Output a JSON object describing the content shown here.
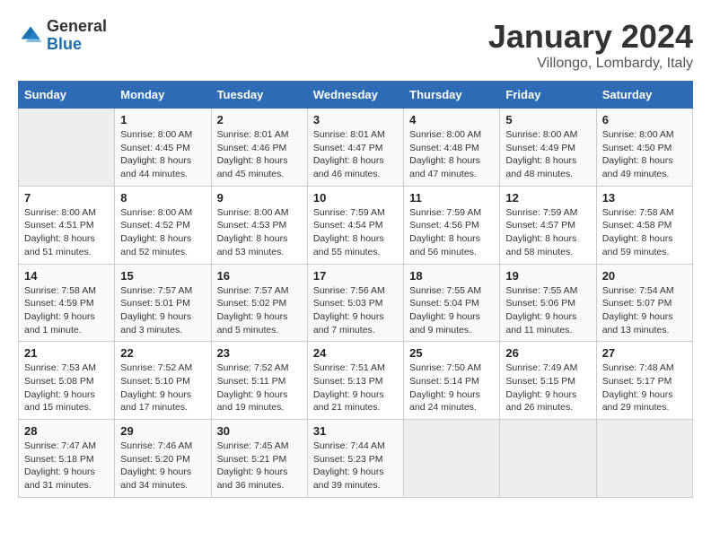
{
  "logo": {
    "general": "General",
    "blue": "Blue"
  },
  "title": "January 2024",
  "subtitle": "Villongo, Lombardy, Italy",
  "days_header": [
    "Sunday",
    "Monday",
    "Tuesday",
    "Wednesday",
    "Thursday",
    "Friday",
    "Saturday"
  ],
  "weeks": [
    [
      {
        "day": "",
        "info": ""
      },
      {
        "day": "1",
        "info": "Sunrise: 8:00 AM\nSunset: 4:45 PM\nDaylight: 8 hours\nand 44 minutes."
      },
      {
        "day": "2",
        "info": "Sunrise: 8:01 AM\nSunset: 4:46 PM\nDaylight: 8 hours\nand 45 minutes."
      },
      {
        "day": "3",
        "info": "Sunrise: 8:01 AM\nSunset: 4:47 PM\nDaylight: 8 hours\nand 46 minutes."
      },
      {
        "day": "4",
        "info": "Sunrise: 8:00 AM\nSunset: 4:48 PM\nDaylight: 8 hours\nand 47 minutes."
      },
      {
        "day": "5",
        "info": "Sunrise: 8:00 AM\nSunset: 4:49 PM\nDaylight: 8 hours\nand 48 minutes."
      },
      {
        "day": "6",
        "info": "Sunrise: 8:00 AM\nSunset: 4:50 PM\nDaylight: 8 hours\nand 49 minutes."
      }
    ],
    [
      {
        "day": "7",
        "info": "Sunrise: 8:00 AM\nSunset: 4:51 PM\nDaylight: 8 hours\nand 51 minutes."
      },
      {
        "day": "8",
        "info": "Sunrise: 8:00 AM\nSunset: 4:52 PM\nDaylight: 8 hours\nand 52 minutes."
      },
      {
        "day": "9",
        "info": "Sunrise: 8:00 AM\nSunset: 4:53 PM\nDaylight: 8 hours\nand 53 minutes."
      },
      {
        "day": "10",
        "info": "Sunrise: 7:59 AM\nSunset: 4:54 PM\nDaylight: 8 hours\nand 55 minutes."
      },
      {
        "day": "11",
        "info": "Sunrise: 7:59 AM\nSunset: 4:56 PM\nDaylight: 8 hours\nand 56 minutes."
      },
      {
        "day": "12",
        "info": "Sunrise: 7:59 AM\nSunset: 4:57 PM\nDaylight: 8 hours\nand 58 minutes."
      },
      {
        "day": "13",
        "info": "Sunrise: 7:58 AM\nSunset: 4:58 PM\nDaylight: 8 hours\nand 59 minutes."
      }
    ],
    [
      {
        "day": "14",
        "info": "Sunrise: 7:58 AM\nSunset: 4:59 PM\nDaylight: 9 hours\nand 1 minute."
      },
      {
        "day": "15",
        "info": "Sunrise: 7:57 AM\nSunset: 5:01 PM\nDaylight: 9 hours\nand 3 minutes."
      },
      {
        "day": "16",
        "info": "Sunrise: 7:57 AM\nSunset: 5:02 PM\nDaylight: 9 hours\nand 5 minutes."
      },
      {
        "day": "17",
        "info": "Sunrise: 7:56 AM\nSunset: 5:03 PM\nDaylight: 9 hours\nand 7 minutes."
      },
      {
        "day": "18",
        "info": "Sunrise: 7:55 AM\nSunset: 5:04 PM\nDaylight: 9 hours\nand 9 minutes."
      },
      {
        "day": "19",
        "info": "Sunrise: 7:55 AM\nSunset: 5:06 PM\nDaylight: 9 hours\nand 11 minutes."
      },
      {
        "day": "20",
        "info": "Sunrise: 7:54 AM\nSunset: 5:07 PM\nDaylight: 9 hours\nand 13 minutes."
      }
    ],
    [
      {
        "day": "21",
        "info": "Sunrise: 7:53 AM\nSunset: 5:08 PM\nDaylight: 9 hours\nand 15 minutes."
      },
      {
        "day": "22",
        "info": "Sunrise: 7:52 AM\nSunset: 5:10 PM\nDaylight: 9 hours\nand 17 minutes."
      },
      {
        "day": "23",
        "info": "Sunrise: 7:52 AM\nSunset: 5:11 PM\nDaylight: 9 hours\nand 19 minutes."
      },
      {
        "day": "24",
        "info": "Sunrise: 7:51 AM\nSunset: 5:13 PM\nDaylight: 9 hours\nand 21 minutes."
      },
      {
        "day": "25",
        "info": "Sunrise: 7:50 AM\nSunset: 5:14 PM\nDaylight: 9 hours\nand 24 minutes."
      },
      {
        "day": "26",
        "info": "Sunrise: 7:49 AM\nSunset: 5:15 PM\nDaylight: 9 hours\nand 26 minutes."
      },
      {
        "day": "27",
        "info": "Sunrise: 7:48 AM\nSunset: 5:17 PM\nDaylight: 9 hours\nand 29 minutes."
      }
    ],
    [
      {
        "day": "28",
        "info": "Sunrise: 7:47 AM\nSunset: 5:18 PM\nDaylight: 9 hours\nand 31 minutes."
      },
      {
        "day": "29",
        "info": "Sunrise: 7:46 AM\nSunset: 5:20 PM\nDaylight: 9 hours\nand 34 minutes."
      },
      {
        "day": "30",
        "info": "Sunrise: 7:45 AM\nSunset: 5:21 PM\nDaylight: 9 hours\nand 36 minutes."
      },
      {
        "day": "31",
        "info": "Sunrise: 7:44 AM\nSunset: 5:23 PM\nDaylight: 9 hours\nand 39 minutes."
      },
      {
        "day": "",
        "info": ""
      },
      {
        "day": "",
        "info": ""
      },
      {
        "day": "",
        "info": ""
      }
    ]
  ]
}
